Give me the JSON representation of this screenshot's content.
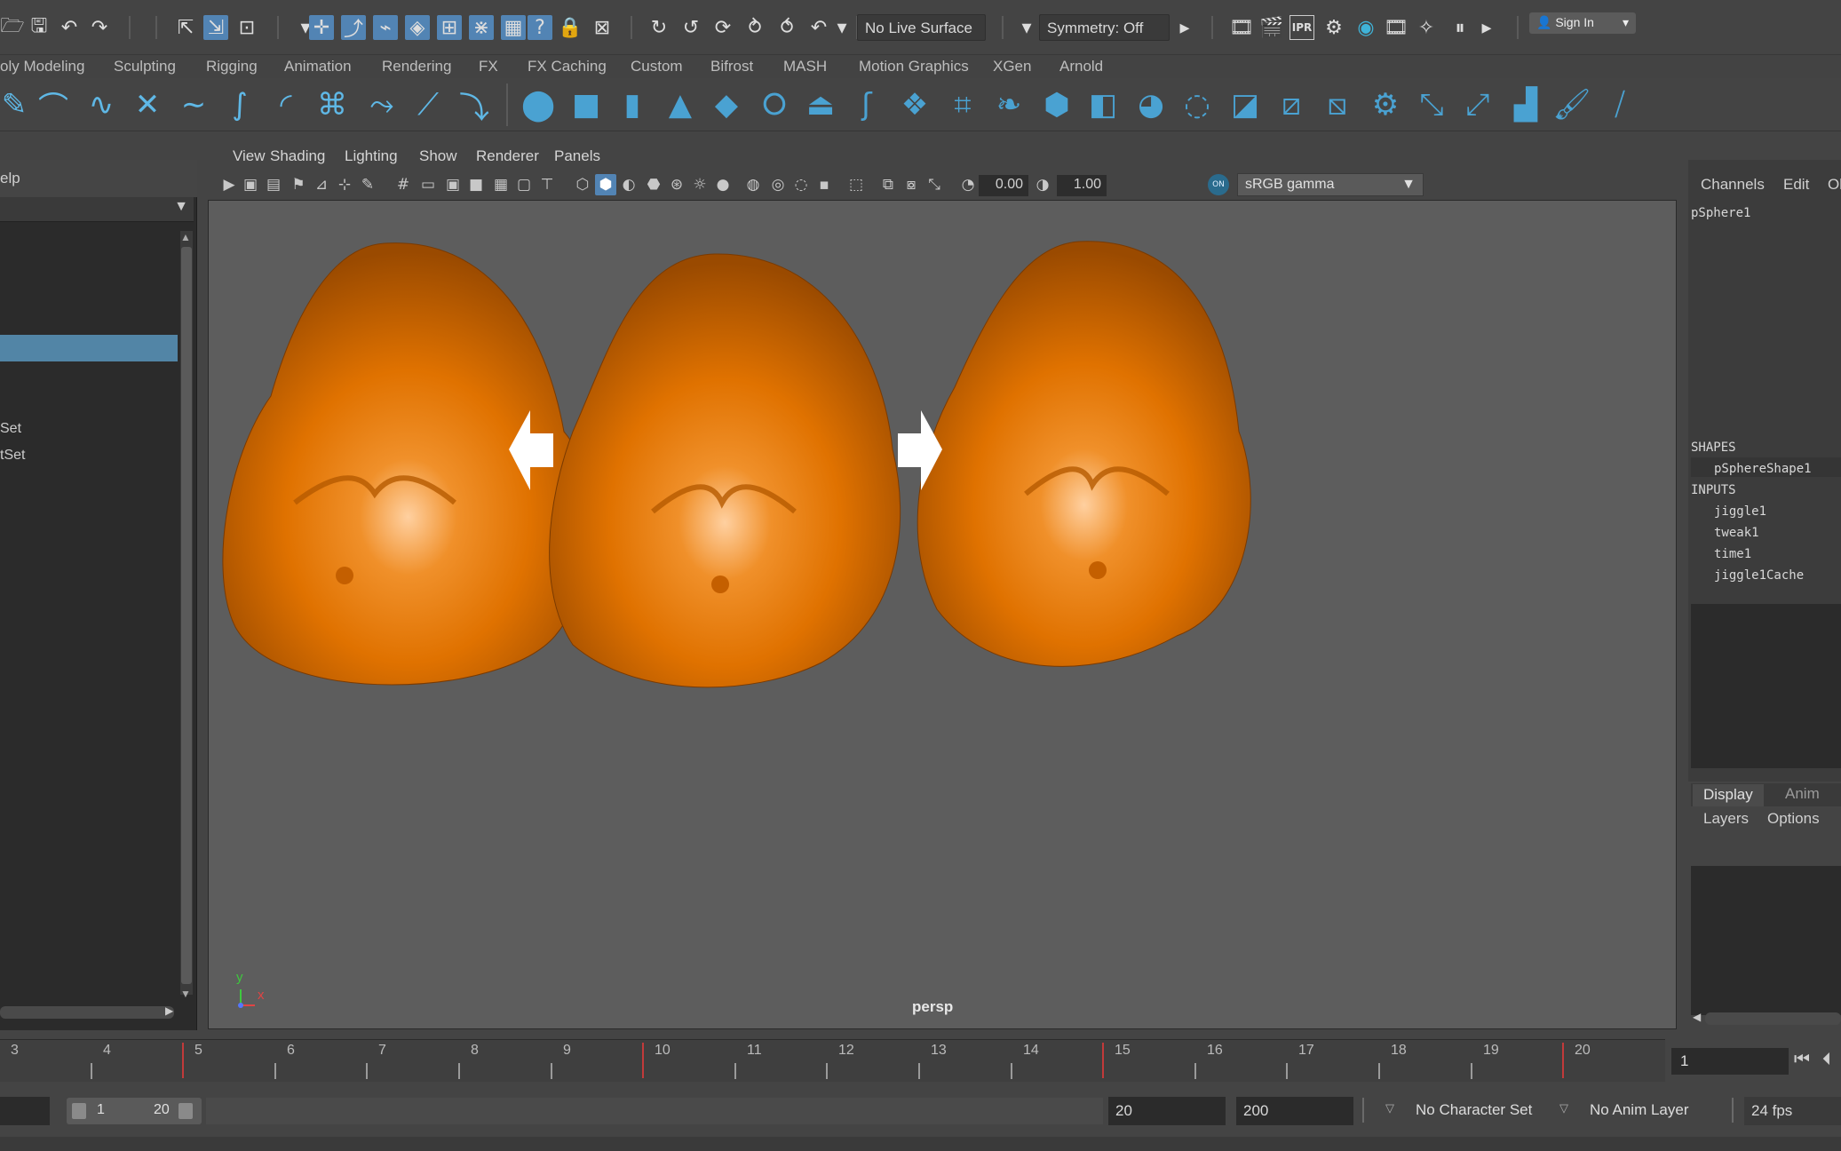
{
  "status_line": {
    "live_surface": "No Live Surface",
    "symmetry": "Symmetry: Off",
    "sign_in": "Sign In",
    "ipr_label": "IPR"
  },
  "shelf_tabs": [
    "oly Modeling",
    "Sculpting",
    "Rigging",
    "Animation",
    "Rendering",
    "FX",
    "FX Caching",
    "Custom",
    "Bifrost",
    "MASH",
    "Motion Graphics",
    "XGen",
    "Arnold"
  ],
  "outliner": {
    "menu_label": "elp",
    "items": [
      "Set",
      "tSet"
    ]
  },
  "viewport": {
    "menus": [
      "View",
      "Shading",
      "Lighting",
      "Show",
      "Renderer",
      "Panels"
    ],
    "exposure": "0.00",
    "gamma": "1.00",
    "color_space": "sRGB gamma",
    "camera_label": "persp",
    "axis_y": "y",
    "axis_x": "x"
  },
  "channel_box": {
    "tabs": [
      "Channels",
      "Edit",
      "Ol"
    ],
    "node_name": "pSphere1",
    "shapes_header": "SHAPES",
    "shape_name": "pSphereShape1",
    "inputs_header": "INPUTS",
    "inputs": [
      "jiggle1",
      "tweak1",
      "time1",
      "jiggle1Cache"
    ]
  },
  "layer_editor": {
    "tabs": [
      "Display",
      "Anim"
    ],
    "menus": [
      "Layers",
      "Options"
    ]
  },
  "timeline": {
    "ticks": [
      "3",
      "4",
      "5",
      "6",
      "7",
      "8",
      "9",
      "10",
      "11",
      "12",
      "13",
      "14",
      "15",
      "16",
      "17",
      "18",
      "19",
      "20"
    ],
    "current_frame": "1"
  },
  "range": {
    "start": "1",
    "end": "20",
    "playback_end": "20",
    "anim_end": "200",
    "character_set": "No Character Set",
    "anim_layer": "No Anim Layer",
    "fps": "24 fps"
  },
  "colors": {
    "accent": "#5284b4",
    "shelf_curve": "#5fb8e6",
    "selection": "#5285a6",
    "model_orange": "#e07000",
    "timeline_key": "#c23a3a"
  }
}
